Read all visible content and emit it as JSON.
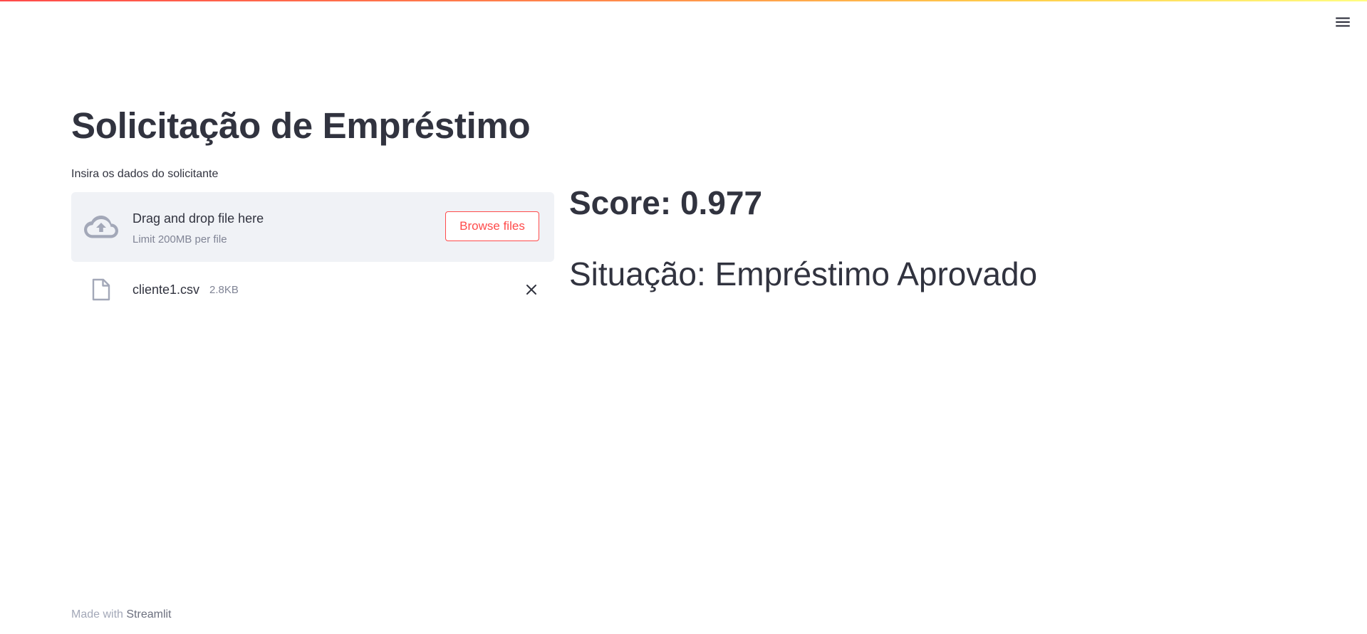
{
  "header": {
    "menu_icon": "hamburger-menu-icon",
    "accent_gradient": [
      "#ff4b4b",
      "#ffcf4b",
      "#fffd80"
    ]
  },
  "main": {
    "title": "Solicitação de Empréstimo",
    "uploader": {
      "label": "Insira os dados do solicitante",
      "drop_text": "Drag and drop file here",
      "limit_text": "Limit 200MB per file",
      "browse_label": "Browse files",
      "cloud_icon": "cloud-upload-icon"
    },
    "uploaded_file": {
      "name": "cliente1.csv",
      "size": "2.8KB",
      "file_icon": "file-icon",
      "remove_icon": "close-icon"
    }
  },
  "result": {
    "score": "Score: 0.977",
    "situacao": "Situação: Empréstimo Aprovado"
  },
  "footer": {
    "prefix": "Made with",
    "link": "Streamlit"
  },
  "colors": {
    "text": "#31333f",
    "muted": "#808495",
    "accent": "#ff4b4b",
    "dropzone_bg": "#f0f2f6"
  }
}
